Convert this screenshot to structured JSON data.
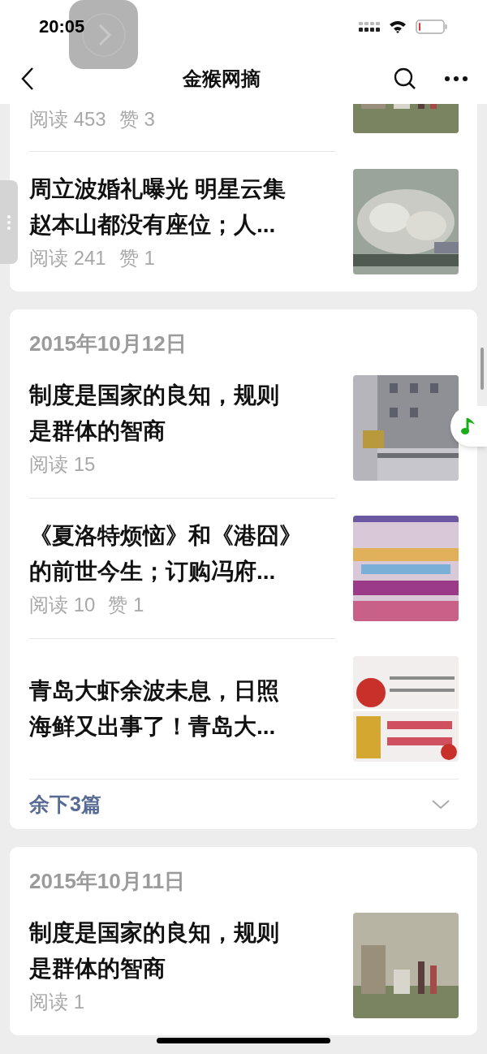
{
  "status_bar": {
    "time": "20:05"
  },
  "nav": {
    "title": "金猴网摘"
  },
  "groups": [
    {
      "articles": [
        {
          "reads": "阅读 453",
          "likes": "赞 3"
        },
        {
          "title_lines": [
            "周立波婚礼曝光 明星云集",
            "赵本山都没有座位；人..."
          ],
          "reads": "阅读 241",
          "likes": "赞 1"
        }
      ]
    },
    {
      "date": "2015年10月12日",
      "articles": [
        {
          "title_lines": [
            "制度是国家的良知，规则",
            "是群体的智商"
          ],
          "reads": "阅读 15"
        },
        {
          "title_lines": [
            "《夏洛特烦恼》和《港囧》",
            "的前世今生；订购冯府..."
          ],
          "reads": "阅读 10",
          "likes": "赞 1"
        },
        {
          "title_lines": [
            "青岛大虾余波未息，日照",
            "海鲜又出事了！青岛大..."
          ]
        }
      ],
      "more": "余下3篇"
    },
    {
      "date": "2015年10月11日",
      "articles": [
        {
          "title_lines": [
            "制度是国家的良知，规则",
            "是群体的智商"
          ],
          "reads": "阅读 1"
        }
      ]
    }
  ]
}
